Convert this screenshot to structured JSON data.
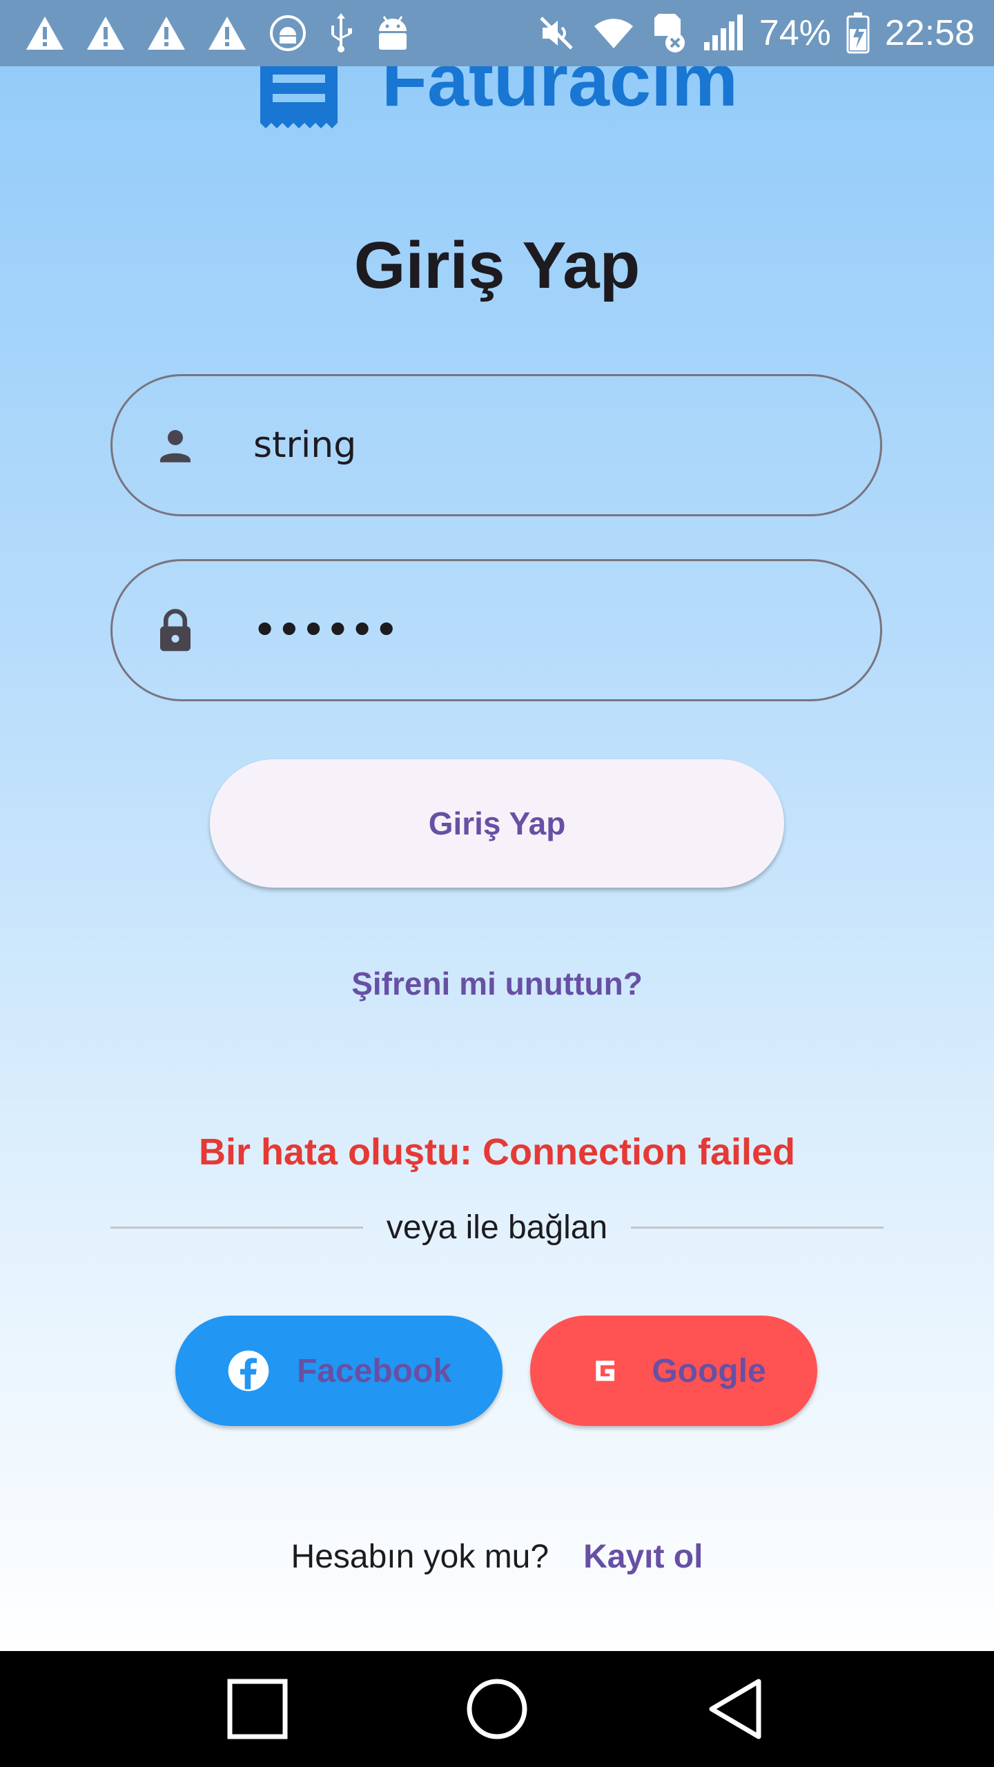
{
  "status_bar": {
    "battery": "74%",
    "time": "22:58",
    "icons": [
      "warning-icon",
      "warning-icon",
      "warning-icon",
      "warning-icon",
      "android-sync-icon",
      "usb-icon",
      "android-icon",
      "mute-icon",
      "wifi-icon",
      "sd-card-error-icon",
      "signal-icon",
      "battery-charging-icon"
    ]
  },
  "app": {
    "name": "Faturacım",
    "logo_icon": "receipt-icon",
    "brand_color": "#1976d2"
  },
  "login": {
    "title": "Giriş Yap",
    "username": {
      "icon": "person-icon",
      "value": "string"
    },
    "password": {
      "icon": "lock-icon",
      "value": "••••••"
    },
    "submit_label": "Giriş Yap",
    "forgot_label": "Şifreni mi unuttun?",
    "error_text": "Bir hata oluştu: Connection failed",
    "accent_color": "#6750a4",
    "error_color": "#e53935"
  },
  "social": {
    "divider_text": "veya ile bağlan",
    "facebook": {
      "label": "Facebook",
      "icon": "facebook-icon",
      "color": "#2196f3"
    },
    "google": {
      "label": "Google",
      "icon": "google-icon",
      "color": "#ff5252"
    }
  },
  "signup": {
    "question": "Hesabın yok mu?",
    "link_label": "Kayıt ol"
  },
  "nav_bar": {
    "buttons": [
      "recents-icon",
      "home-icon",
      "back-icon"
    ]
  }
}
